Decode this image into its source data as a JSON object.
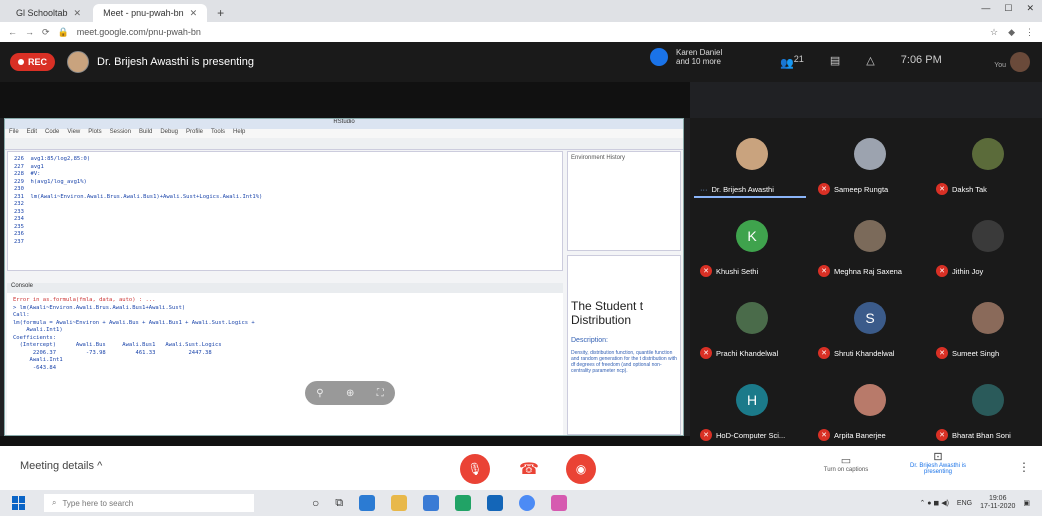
{
  "browser": {
    "tabs": [
      {
        "label": "Gl Schooltab",
        "active": false
      },
      {
        "label": "Meet - pnu-pwah-bn",
        "active": true
      }
    ],
    "url": "meet.google.com/pnu-pwah-bn"
  },
  "meet_header": {
    "rec_label": "REC",
    "presenting_text": "Dr. Brijesh Awasthi is presenting",
    "others_line1": "Karen Daniel",
    "others_line2": "and 10 more",
    "participant_count": "21",
    "time": "7:06 PM",
    "you_label": "You"
  },
  "presentation": {
    "rstudio_title": "RStudio",
    "menu": [
      "File",
      "Edit",
      "Code",
      "View",
      "Plots",
      "Session",
      "Build",
      "Debug",
      "Profile",
      "Tools",
      "Help"
    ],
    "editor_lines": [
      "226  avg1:85/log2,85:0)",
      "227  avg1",
      "228  #V:",
      "229  h(avg1/log_avg1%)",
      "230",
      "231  lm(Awali~Environ.Awali.Brus.Awali.Bus1)+Awali.Sust+Logics.Awali.Int1%)",
      "232",
      "233",
      "234",
      "235",
      "236",
      "237"
    ],
    "console_label": "Console",
    "console_lines": [
      "Error in as.formula(fmla, data, auto) : ...",
      "> lm(Awali~Environ.Awali.Brus.Awali.Bus1+Awali.Sust)",
      "",
      "Call:",
      "lm(formula = Awali~Environ + Awali.Bus + Awali.Bus1 + Awali.Sust.Logics +",
      "    Awali.Int1)",
      "",
      "Coefficients:",
      "  (Intercept)      Awali.Bus     Awali.Bus1   Awali.Sust.Logics",
      "      2206.37         -73.98         461.33          2447.38",
      "     Awali.Int1",
      "      -643.84"
    ],
    "env_tabs": "Environment  History",
    "help_title": "The Student t Distribution",
    "help_desc": "Description:",
    "help_body": "Density, distribution function, quantile function and random generation for the t distribution with df degrees of freedom (and optional non-centrality parameter ncp)."
  },
  "participants": [
    {
      "name": "Dr. Brijesh Awasthi",
      "initial": "",
      "color": "#c9a37e",
      "muted": false,
      "selected": true
    },
    {
      "name": "Sameep Rungta",
      "initial": "",
      "color": "#9ca3af",
      "muted": true,
      "selected": false
    },
    {
      "name": "Daksh Tak",
      "initial": "",
      "color": "#5b6b3a",
      "muted": true,
      "selected": false
    },
    {
      "name": "Khushi Sethi",
      "initial": "K",
      "color": "#3fa34d",
      "muted": true,
      "selected": false
    },
    {
      "name": "Meghna Raj Saxena",
      "initial": "",
      "color": "#7b6a5a",
      "muted": true,
      "selected": false
    },
    {
      "name": "Jithin Joy",
      "initial": "",
      "color": "#3a3a3a",
      "muted": true,
      "selected": false
    },
    {
      "name": "Prachi Khandelwal",
      "initial": "",
      "color": "#4a6b4a",
      "muted": true,
      "selected": false
    },
    {
      "name": "Shruti Khandelwal",
      "initial": "S",
      "color": "#3b5b8a",
      "muted": true,
      "selected": false
    },
    {
      "name": "Sumeet Singh",
      "initial": "",
      "color": "#8a6a5a",
      "muted": true,
      "selected": false
    },
    {
      "name": "HoD-Computer Sci...",
      "initial": "H",
      "color": "#1b7a8a",
      "muted": true,
      "selected": false
    },
    {
      "name": "Arpita Banerjee",
      "initial": "",
      "color": "#b87a6a",
      "muted": true,
      "selected": false
    },
    {
      "name": "Bharat Bhan Soni",
      "initial": "",
      "color": "#2a5a5a",
      "muted": true,
      "selected": false
    }
  ],
  "meet_bottom": {
    "meeting_details": "Meeting details",
    "captions_label": "Turn on captions",
    "presenting_label": "Dr. Brijesh Awasthi is presenting"
  },
  "taskbar": {
    "search_placeholder": "Type here to search",
    "time": "19:06",
    "date": "17-11-2020",
    "lang": "ENG"
  },
  "colors": {
    "rec_red": "#d93025",
    "end_call_red": "#ea4335",
    "accent_blue": "#1a73e8"
  }
}
